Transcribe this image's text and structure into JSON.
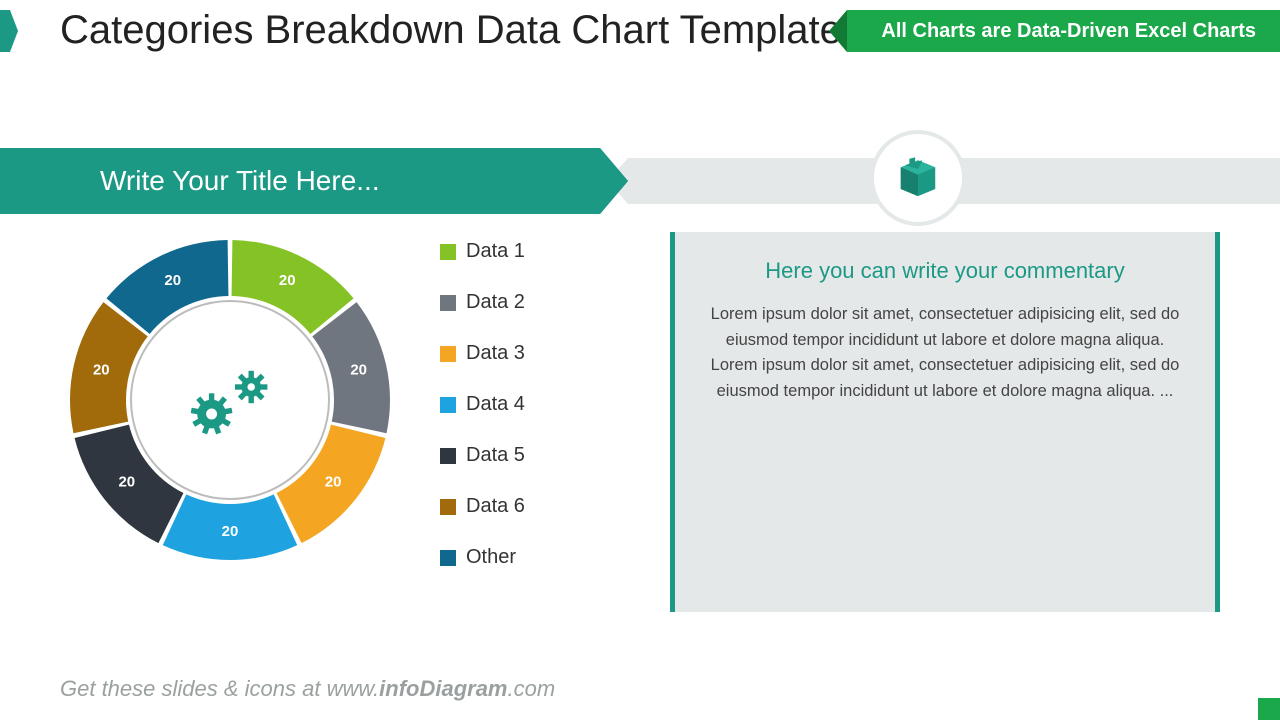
{
  "header": {
    "title": "Categories Breakdown Data Chart Template",
    "ribbon": "All Charts are Data-Driven Excel Charts"
  },
  "banner": {
    "title": "Write Your Title Here..."
  },
  "chart_data": {
    "type": "pie",
    "title": "",
    "series": [
      {
        "name": "Data 1",
        "value": 20,
        "color": "#85c226"
      },
      {
        "name": "Data 2",
        "value": 20,
        "color": "#6f7680"
      },
      {
        "name": "Data 3",
        "value": 20,
        "color": "#f4a623"
      },
      {
        "name": "Data 4",
        "value": 20,
        "color": "#1ea3e0"
      },
      {
        "name": "Data 5",
        "value": 20,
        "color": "#2f3640"
      },
      {
        "name": "Data 6",
        "value": 20,
        "color": "#a16b0b"
      },
      {
        "name": "Other",
        "value": 20,
        "color": "#11688f"
      }
    ]
  },
  "commentary": {
    "title": "Here you can write your commentary",
    "body": "Lorem ipsum dolor sit amet, consectetuer adipisicing elit, sed do eiusmod tempor incididunt ut labore et dolore magna aliqua. Lorem ipsum dolor sit amet, consectetuer adipisicing elit, sed do eiusmod tempor incididunt ut labore et dolore magna aliqua. ..."
  },
  "footer": {
    "prefix": "Get these slides & icons at www.",
    "bold": "infoDiagram",
    "suffix": ".com"
  }
}
